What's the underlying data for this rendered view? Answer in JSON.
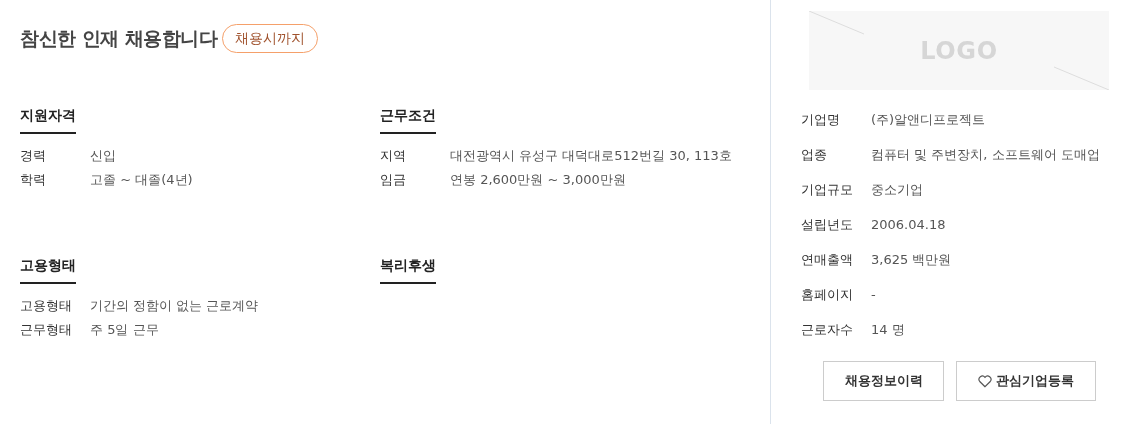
{
  "title": "참신한 인재 채용합니다",
  "deadline_badge": "채용시까지",
  "sections": [
    {
      "heading": "지원자격",
      "rows": [
        {
          "label": "경력",
          "value": "신입"
        },
        {
          "label": "학력",
          "value": "고졸 ~ 대졸(4년)"
        }
      ]
    },
    {
      "heading": "근무조건",
      "rows": [
        {
          "label": "지역",
          "value": "대전광역시 유성구 대덕대로512번길 30, 113호"
        },
        {
          "label": "임금",
          "value": "연봉 2,600만원 ~ 3,000만원"
        }
      ]
    },
    {
      "heading": "고용형태",
      "rows": [
        {
          "label": "고용형태",
          "value": "기간의 정함이 없는 근로계약"
        },
        {
          "label": "근무형태",
          "value": "주 5일 근무"
        }
      ]
    },
    {
      "heading": "복리후생"
    }
  ],
  "company": {
    "logo_text": "LOGO",
    "rows": [
      {
        "label": "기업명",
        "value": "(주)알앤디프로젝트"
      },
      {
        "label": "업종",
        "value": "컴퓨터 및 주변장치, 소프트웨어 도매업"
      },
      {
        "label": "기업규모",
        "value": "중소기업"
      },
      {
        "label": "설립년도",
        "value": "2006.04.18"
      },
      {
        "label": "연매출액",
        "value": "3,625 백만원"
      },
      {
        "label": "홈페이지",
        "value": "-"
      },
      {
        "label": "근로자수",
        "value": "14 명"
      }
    ]
  },
  "buttons": [
    {
      "label": "채용정보이력"
    },
    {
      "label": "관심기업등록"
    }
  ]
}
